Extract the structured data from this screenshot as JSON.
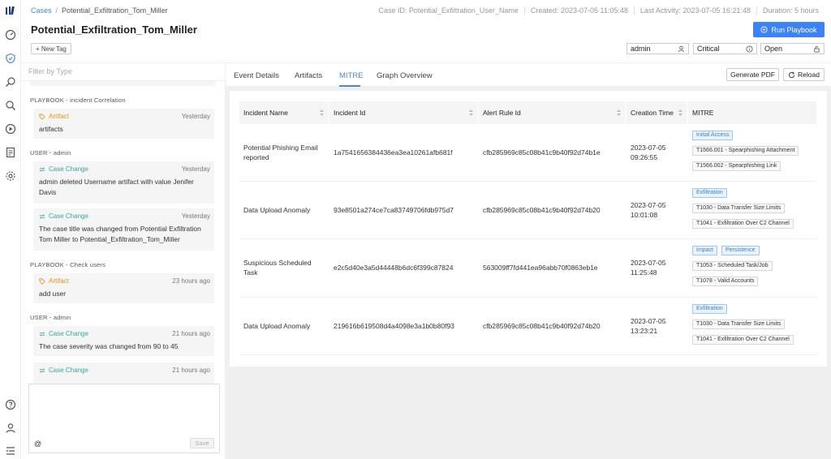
{
  "header": {
    "breadcrumb_root": "Cases",
    "breadcrumb_current": "Potential_Exfiltration_Tom_Miller",
    "case_id": "Case ID: Potential_Exfiltration_User_Name",
    "created": "Created: 2023-07-05 11:05:48",
    "last_activity": "Last Activity: 2023-07-05 16:21:48",
    "duration": "Duration: 5 hours",
    "title": "Potential_Exfiltration_Tom_Miller",
    "run_playbook": "Run Playbook",
    "new_tag": "+ New Tag",
    "assignee": "admin",
    "severity": "Critical",
    "status": "Open"
  },
  "left": {
    "filter_placeholder": "Filter by Type",
    "groups": [
      "PLAYBOOK - incident Correlation",
      "USER - admin",
      "PLAYBOOK - Check users",
      "USER - admin"
    ],
    "cards": [
      {
        "type": "Artifact",
        "time": "Yesterday",
        "text": "artifacts"
      },
      {
        "type": "Case Change",
        "time": "Yesterday",
        "text": "admin deleted Username artifact with value Jenifer Davis"
      },
      {
        "type": "Case Change",
        "time": "Yesterday",
        "text": "The case title was changed from Potential Exfiltration Tom Miller to Potential_Exfiltration_Tom_Miller"
      },
      {
        "type": "Artifact",
        "time": "23 hours ago",
        "text": "add user"
      },
      {
        "type": "Case Change",
        "time": "21 hours ago",
        "text": "The case severity was changed from 90 to 45"
      },
      {
        "type": "Case Change",
        "time": "21 hours ago",
        "text": ""
      }
    ],
    "composer": {
      "mention": "@",
      "save": "Save"
    }
  },
  "tabs": [
    "Event Details",
    "Artifacts",
    "MITRE",
    "Graph Overview"
  ],
  "actions": {
    "generate_pdf": "Generate PDF",
    "reload": "Reload"
  },
  "table": {
    "columns": [
      "Incident Name",
      "Incident Id",
      "Alert Rule Id",
      "Creation Time",
      "MITRE"
    ],
    "rows": [
      {
        "name": "Potential Phishing Email reported",
        "incident_id": "1a7541656384436ea3ea10261afb681f",
        "rule_id": "cfb285969c85c08b41c9b40f92d74b1e",
        "date": "2023-07-05",
        "time": "09:26:55",
        "tactics": [
          "Initial Access"
        ],
        "techniques": [
          "T1566.001 - Spearphishing Attachment",
          "T1566.002 - Spearphishing Link"
        ]
      },
      {
        "name": "Data Upload Anomaly",
        "incident_id": "93e8501a274ce7ca83749706fdb975d7",
        "rule_id": "cfb285969c85c08b41c9b40f92d74b20",
        "date": "2023-07-05",
        "time": "10:01:08",
        "tactics": [
          "Exfiltration"
        ],
        "techniques": [
          "T1030 - Data Transfer Size Limits",
          "T1041 - Exfiltration Over C2 Channel"
        ]
      },
      {
        "name": "Suspicious Scheduled Task",
        "incident_id": "e2c5d40e3a5d44448b6dc6f399c87824",
        "rule_id": "563009ff7fd441ea96abb70f0863eb1e",
        "date": "2023-07-05",
        "time": "11:25:48",
        "tactics": [
          "Impact",
          "Persistence"
        ],
        "techniques": [
          "T1053 - Scheduled Task/Job",
          "T1078 - Valid Accounts"
        ]
      },
      {
        "name": "Data Upload Anomaly",
        "incident_id": "219616b619508d4a4098e3a1b0b80f93",
        "rule_id": "cfb285969c85c08b41c9b40f92d74b20",
        "date": "2023-07-05",
        "time": "13:23:21",
        "tactics": [
          "Exfiltration"
        ],
        "techniques": [
          "T1030 - Data Transfer Size Limits",
          "T1041 - Exfiltration Over C2 Channel"
        ]
      }
    ]
  }
}
